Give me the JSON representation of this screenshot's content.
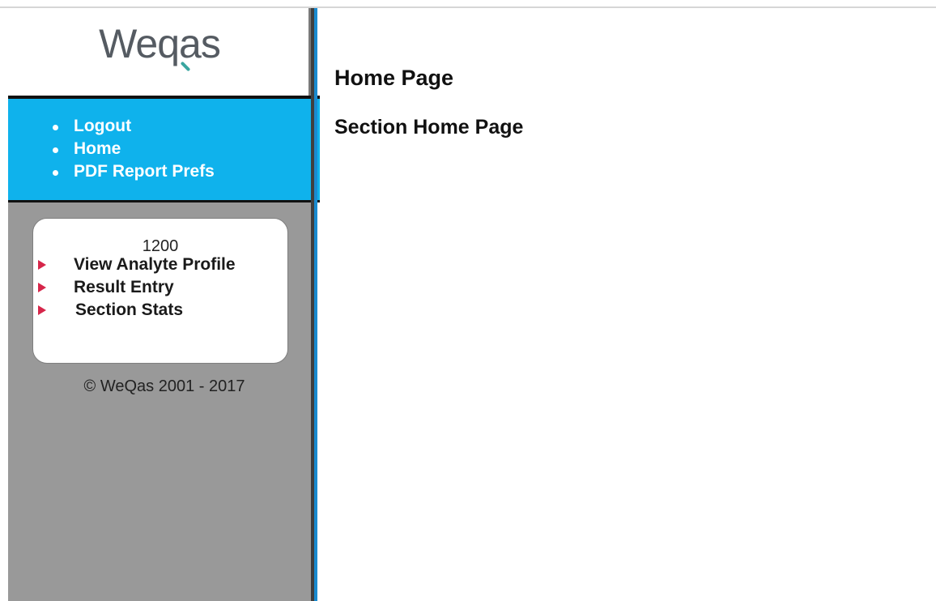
{
  "logo": {
    "text": "Weqas"
  },
  "nav": {
    "items": [
      {
        "label": "Logout"
      },
      {
        "label": "Home"
      },
      {
        "label": "PDF Report Prefs"
      }
    ]
  },
  "panel": {
    "number": "1200",
    "links": [
      {
        "label": "View Analyte Profile"
      },
      {
        "label": "Result Entry"
      },
      {
        "label": "Section Stats"
      }
    ]
  },
  "footer": {
    "copyright": "© WeQas 2001 - 2017"
  },
  "main": {
    "title": "Home Page",
    "section_title": "Section Home Page"
  },
  "colors": {
    "nav_band": "#0fb2ec",
    "sidebar": "#999999",
    "arrow": "#d6264a",
    "divider_blue": "#1a8bd0",
    "logo_accent": "#3aa6a0"
  }
}
